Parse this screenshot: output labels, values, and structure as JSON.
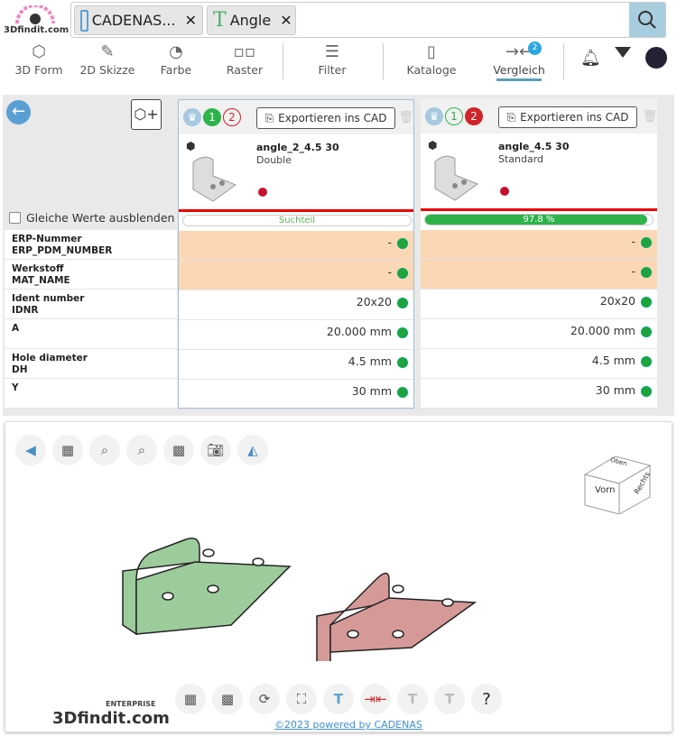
{
  "logo": {
    "text": "3Dfindit.com"
  },
  "search": {
    "chips": [
      {
        "label": "CADENAS...",
        "icon": "catalog-folder-icon"
      },
      {
        "label": "Angle",
        "icon": "text-t-icon"
      }
    ]
  },
  "toolbar": {
    "items": [
      {
        "label": "3D Form",
        "icon": "cube-icon"
      },
      {
        "label": "2D Skizze",
        "icon": "pencil-icon"
      },
      {
        "label": "Farbe",
        "icon": "palette-icon"
      },
      {
        "label": "Raster",
        "icon": "grid-icon"
      },
      {
        "label": "Filter",
        "icon": "sliders-icon"
      },
      {
        "label": "Kataloge",
        "icon": "book-icon"
      },
      {
        "label": "Vergleich",
        "icon": "compare-icon",
        "badge": "2"
      }
    ]
  },
  "compare": {
    "hide_same_label": "Gleiche Werte ausblenden",
    "rows": [
      {
        "label": "ERP-Nummer",
        "sub": "ERP_PDM_NUMBER"
      },
      {
        "label": "Werkstoff",
        "sub": "MAT_NAME"
      },
      {
        "label": "Ident number",
        "sub": "IDNR"
      },
      {
        "label": "A",
        "sub": ""
      },
      {
        "label": "Hole diameter",
        "sub": "DH"
      },
      {
        "label": "Y",
        "sub": ""
      }
    ],
    "export_label": "Exportieren ins CAD",
    "cards": [
      {
        "num1": "1",
        "num2": "2",
        "name": "angle_2_4.5 30",
        "desc": "Double",
        "bar_label": "Suchteil",
        "match_percent": 0,
        "values": [
          "-",
          "-",
          "20x20",
          "20.000 mm",
          "4.5 mm",
          "30 mm"
        ]
      },
      {
        "num1": "1",
        "num2": "2",
        "name": "angle_4.5 30",
        "desc": "Standard",
        "bar_label": "97.8 %",
        "match_percent": 97.8,
        "values": [
          "-",
          "-",
          "20x20",
          "20.000 mm",
          "4.5 mm",
          "30 mm"
        ]
      }
    ]
  },
  "viewer": {
    "cube_labels": {
      "front": "Vorn",
      "right": "Rechts",
      "top": "Oben"
    },
    "enterprise": "ENTERPRISE",
    "logo": "3Dfindit.com",
    "footer_link": "©2023 powered by CADENAS"
  },
  "colors": {
    "accent": "#3d9bd6",
    "green": "#2db34a",
    "red": "#d0232a",
    "orange": "#fbd7b5"
  }
}
